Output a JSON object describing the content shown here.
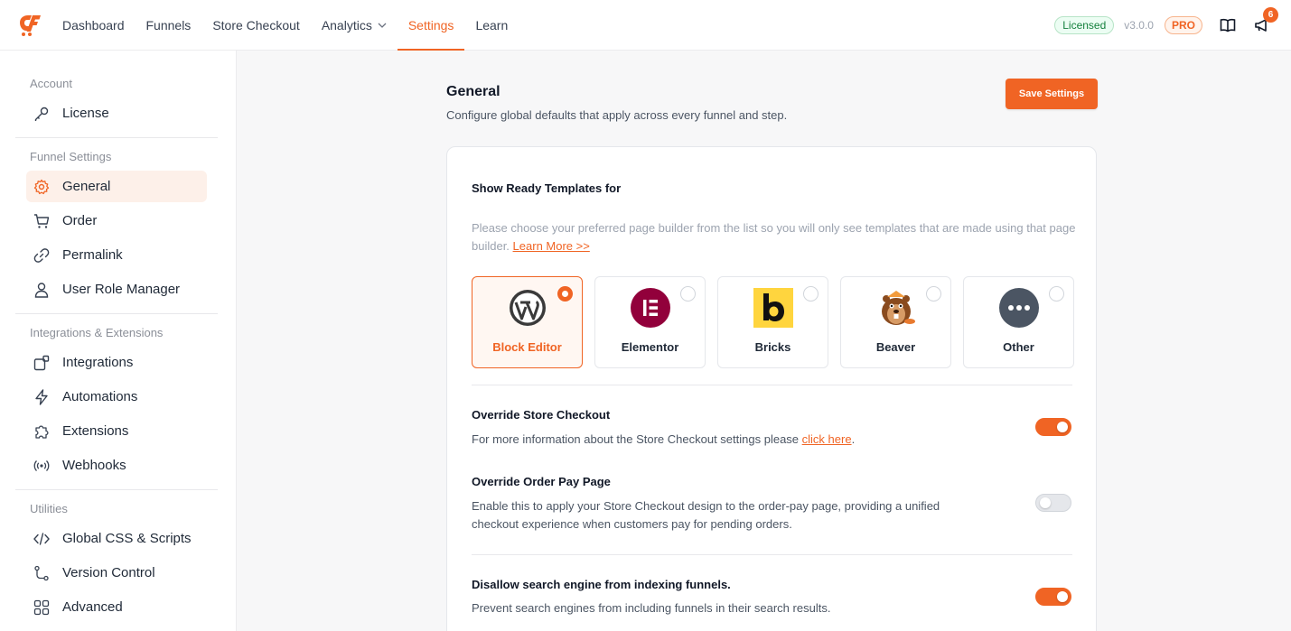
{
  "app": {
    "logo_name": "cartflows-logo"
  },
  "topnav": {
    "items": [
      {
        "label": "Dashboard"
      },
      {
        "label": "Funnels"
      },
      {
        "label": "Store Checkout"
      },
      {
        "label": "Analytics"
      },
      {
        "label": "Settings"
      },
      {
        "label": "Learn"
      }
    ],
    "active": "Settings",
    "license_badge": "Licensed",
    "version": "v3.0.0",
    "pro_badge": "PRO",
    "notification_count": "6",
    "colors": {
      "accent": "#f06424",
      "license_green": "#15803d"
    }
  },
  "sidebar": {
    "sections": [
      {
        "label": "Account"
      },
      {
        "label": "Funnel Settings"
      },
      {
        "label": "Integrations & Extensions"
      },
      {
        "label": "Utilities"
      }
    ],
    "items": [
      {
        "label": "License",
        "icon": "key-icon"
      },
      {
        "label": "General",
        "icon": "gear-icon"
      },
      {
        "label": "Order",
        "icon": "cart-icon"
      },
      {
        "label": "Permalink",
        "icon": "link-icon"
      },
      {
        "label": "User Role Manager",
        "icon": "user-icon"
      },
      {
        "label": "Integrations",
        "icon": "integrations-icon"
      },
      {
        "label": "Automations",
        "icon": "bolt-icon"
      },
      {
        "label": "Extensions",
        "icon": "puzzle-icon"
      },
      {
        "label": "Webhooks",
        "icon": "broadcast-icon"
      },
      {
        "label": "Global CSS & Scripts",
        "icon": "code-icon"
      },
      {
        "label": "Version Control",
        "icon": "git-icon"
      },
      {
        "label": "Advanced",
        "icon": "grid-icon"
      }
    ],
    "active": "General"
  },
  "main": {
    "title": "General",
    "description": "Configure global defaults that apply across every funnel and step.",
    "save_label": "Save Settings",
    "templates": {
      "title": "Show Ready Templates for",
      "desc": "Please choose your preferred page builder from the list so you will only see templates that are made using that page builder.",
      "link": "Learn More >>",
      "builders": [
        {
          "label": "Block Editor",
          "icon": "wordpress-icon",
          "selected": true
        },
        {
          "label": "Elementor",
          "icon": "elementor-icon",
          "selected": false
        },
        {
          "label": "Bricks",
          "icon": "bricks-icon",
          "selected": false
        },
        {
          "label": "Beaver",
          "icon": "beaver-icon",
          "selected": false
        },
        {
          "label": "Other",
          "icon": "more-icon",
          "selected": false
        }
      ]
    },
    "settings": [
      {
        "title": "Override Store Checkout",
        "desc": "For more information about the Store Checkout settings please ",
        "link": "click here",
        "suffix": ".",
        "enabled": true
      },
      {
        "title": "Override Order Pay Page",
        "desc_line1": "Enable this to apply your Store Checkout design to the order-pay page, providing a unified",
        "desc_line2": "checkout experience when customers pay for pending orders.",
        "enabled": false
      },
      {
        "title": "Disallow search engine from indexing funnels.",
        "desc": "Prevent search engines from including funnels in their search results.",
        "enabled": true
      }
    ]
  }
}
